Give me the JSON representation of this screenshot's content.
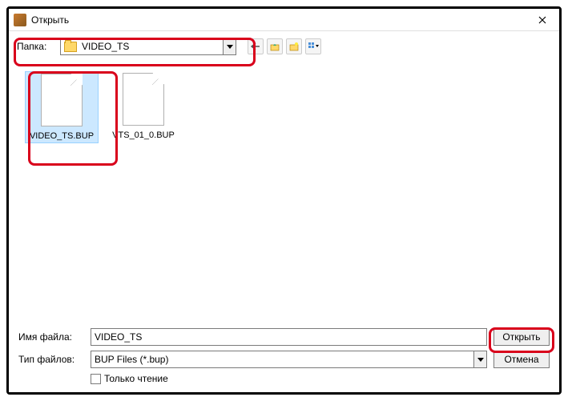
{
  "titlebar": {
    "text": "Открыть"
  },
  "toolbar": {
    "folder_label": "Папка:",
    "folder_value": "VIDEO_TS",
    "icons": {
      "back": "back-icon",
      "up": "up-icon",
      "newfolder": "new-folder-icon",
      "view": "view-icon"
    }
  },
  "files": [
    {
      "name": "VIDEO_TS.BUP",
      "selected": true
    },
    {
      "name": "VTS_01_0.BUP",
      "selected": false
    }
  ],
  "bottom": {
    "filename_label": "Имя файла:",
    "filename_value": "VIDEO_TS",
    "filetype_label": "Тип файлов:",
    "filetype_value": "BUP Files (*.bup)",
    "open_button": "Открыть",
    "cancel_button": "Отмена",
    "readonly_label": "Только чтение"
  }
}
